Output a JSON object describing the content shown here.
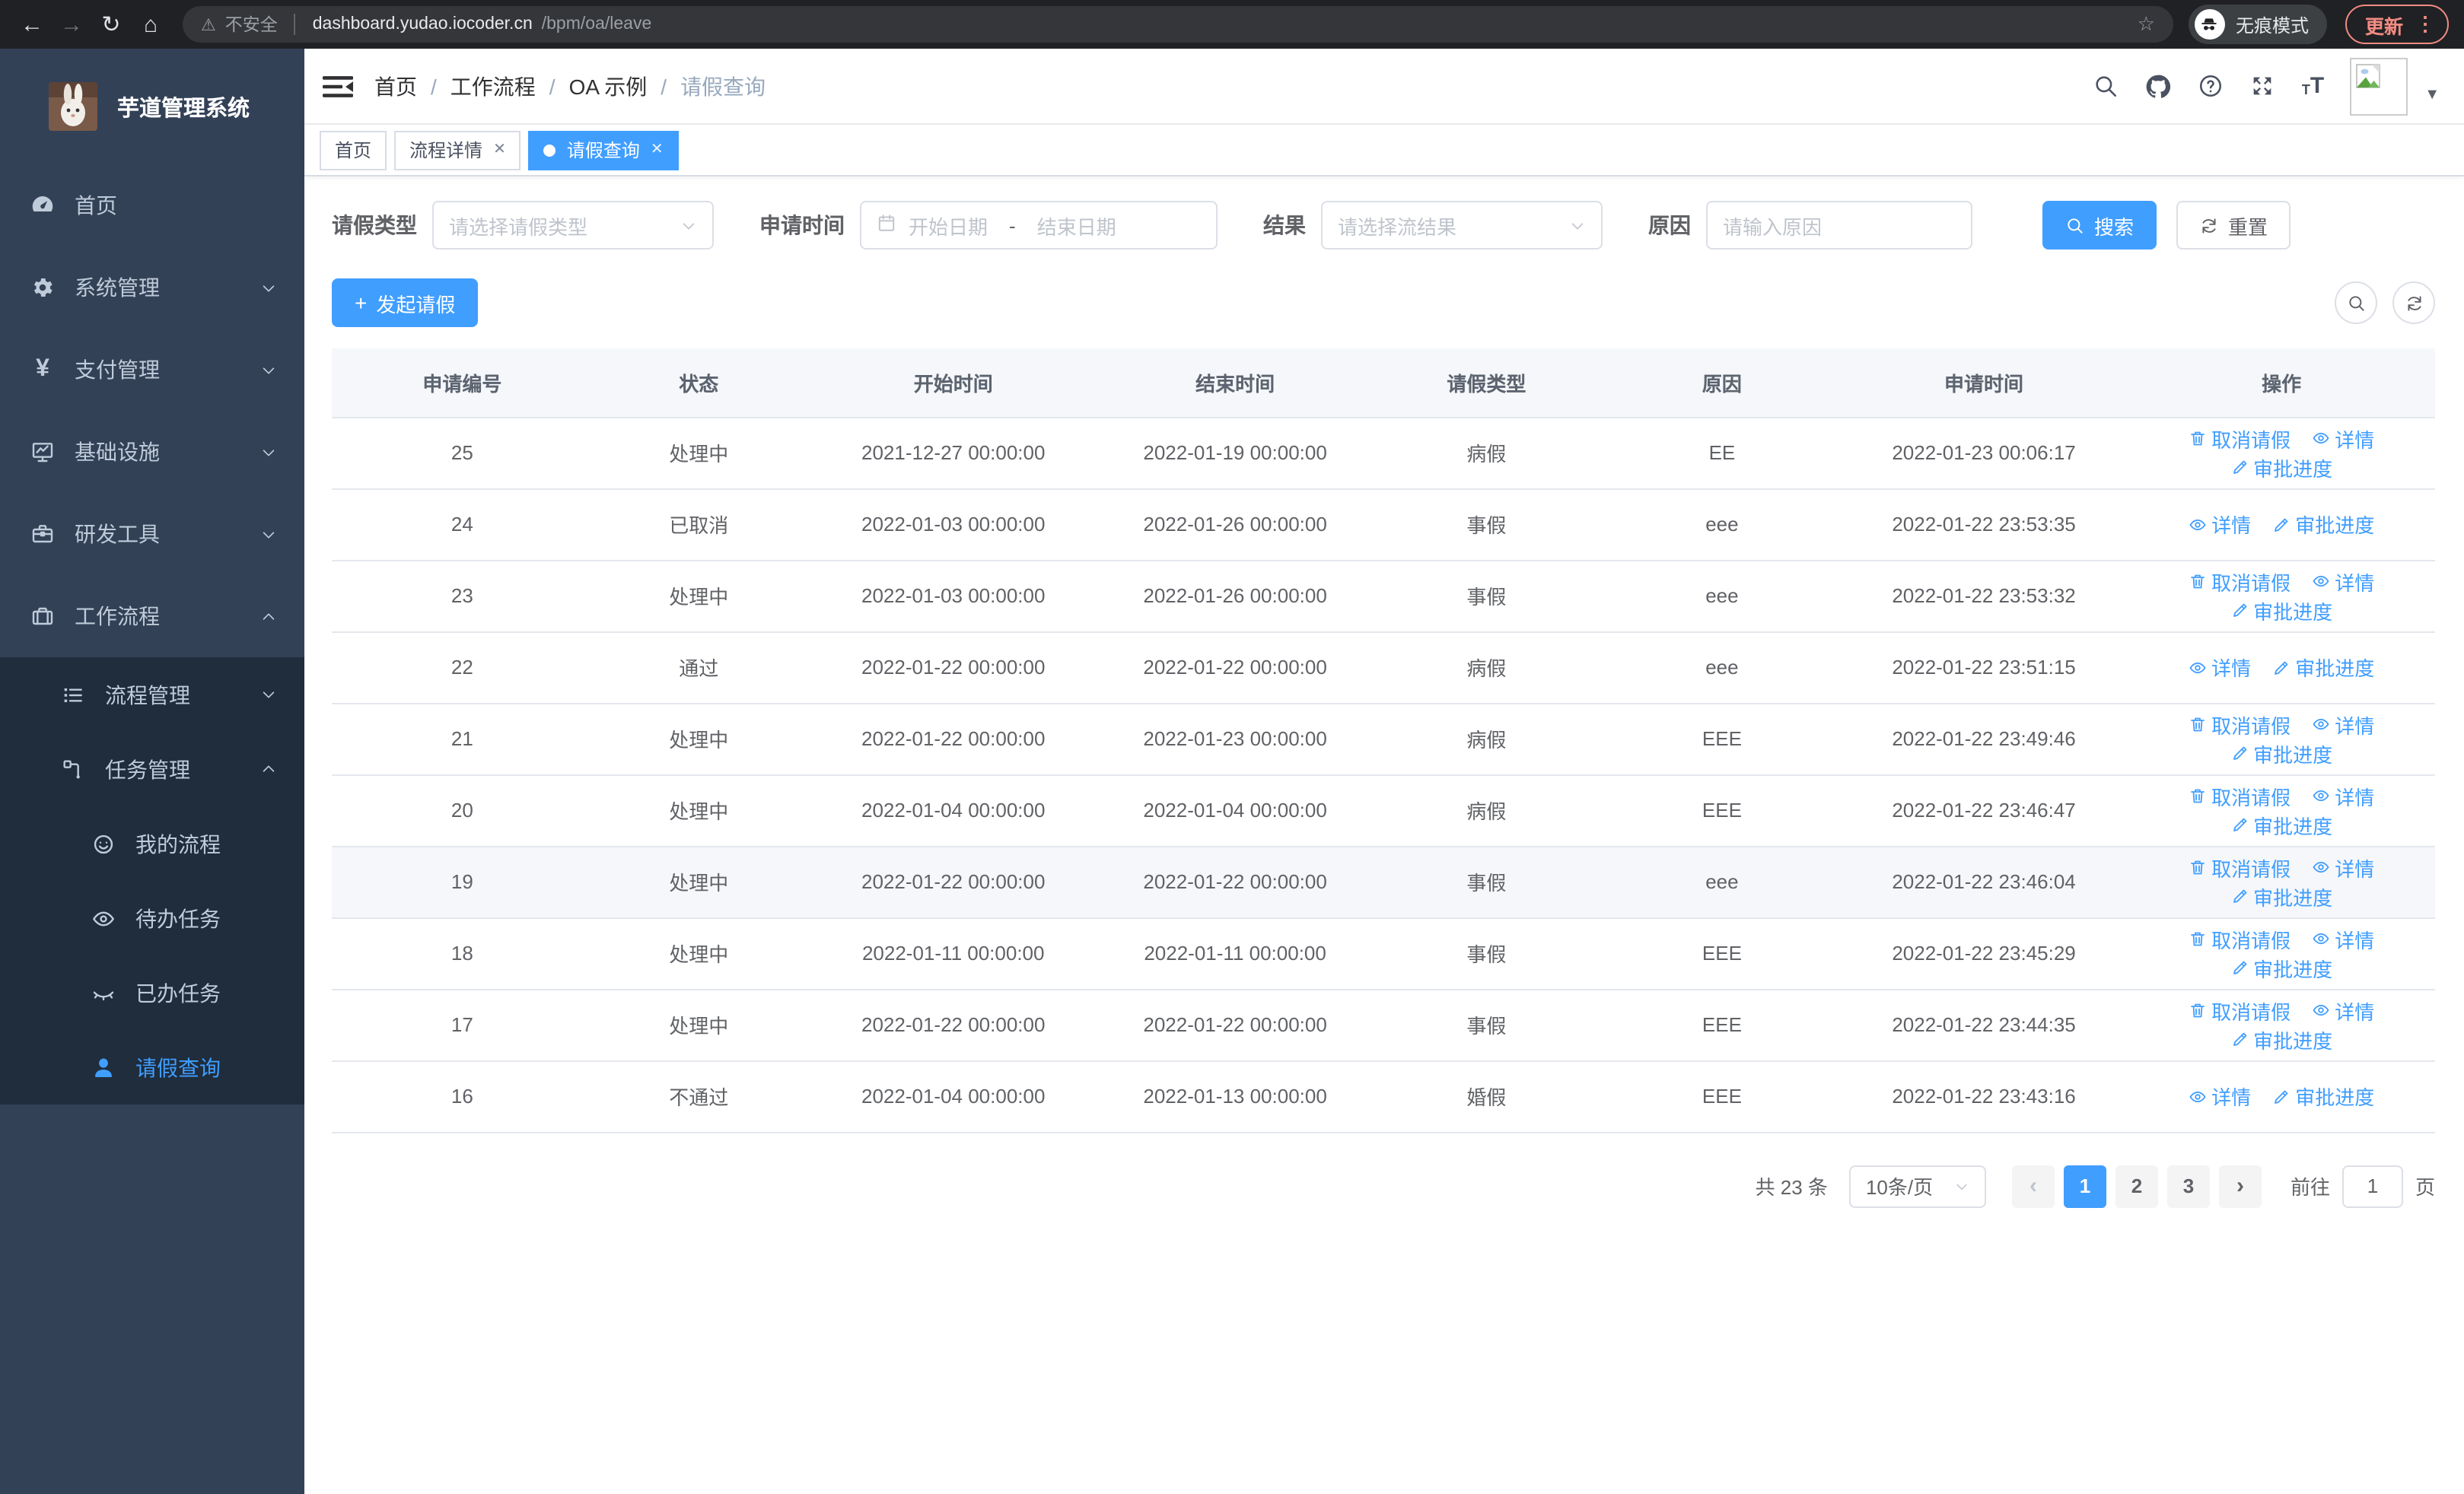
{
  "browser": {
    "security_label": "不安全",
    "url_host": "dashboard.yudao.iocoder.cn",
    "url_path": "/bpm/oa/leave",
    "incognito_label": "无痕模式",
    "update_label": "更新",
    "menu_dots": "⋮"
  },
  "sidebar": {
    "logo_title": "芋道管理系统",
    "items": [
      {
        "label": "首页",
        "icon": "dashboard-icon"
      },
      {
        "label": "系统管理",
        "icon": "gear-icon",
        "chevron": "down"
      },
      {
        "label": "支付管理",
        "icon": "yen-icon",
        "chevron": "down"
      },
      {
        "label": "基础设施",
        "icon": "monitor-icon",
        "chevron": "down"
      },
      {
        "label": "研发工具",
        "icon": "toolbox-icon",
        "chevron": "down"
      },
      {
        "label": "工作流程",
        "icon": "briefcase-icon",
        "chevron": "up"
      }
    ],
    "submenu": [
      {
        "label": "流程管理",
        "icon": "list-icon",
        "chevron": "down"
      },
      {
        "label": "任务管理",
        "icon": "tree-icon",
        "chevron": "up"
      },
      {
        "label": "我的流程",
        "icon": "face-icon"
      },
      {
        "label": "待办任务",
        "icon": "eye-open-icon"
      },
      {
        "label": "已办任务",
        "icon": "eye-closed-icon"
      },
      {
        "label": "请假查询",
        "icon": "user-icon",
        "active": true
      }
    ]
  },
  "header": {
    "breadcrumb": [
      "首页",
      "工作流程",
      "OA 示例",
      "请假查询"
    ],
    "separator": "/"
  },
  "tabs": [
    {
      "label": "首页",
      "closable": false,
      "active": false
    },
    {
      "label": "流程详情",
      "closable": true,
      "active": false
    },
    {
      "label": "请假查询",
      "closable": true,
      "active": true
    }
  ],
  "filters": {
    "leave_type": {
      "label": "请假类型",
      "placeholder": "请选择请假类型"
    },
    "apply_time": {
      "label": "申请时间",
      "start_placeholder": "开始日期",
      "separator": "-",
      "end_placeholder": "结束日期"
    },
    "result": {
      "label": "结果",
      "placeholder": "请选择流结果"
    },
    "reason": {
      "label": "原因",
      "placeholder": "请输入原因"
    },
    "search_label": "搜索",
    "reset_label": "重置"
  },
  "toolbar": {
    "create_label": "发起请假"
  },
  "table": {
    "headers": [
      "申请编号",
      "状态",
      "开始时间",
      "结束时间",
      "请假类型",
      "原因",
      "申请时间",
      "操作"
    ],
    "action_labels": {
      "cancel": "取消请假",
      "detail": "详情",
      "progress": "审批进度"
    },
    "rows": [
      {
        "id": "25",
        "status": "处理中",
        "start": "2021-12-27 00:00:00",
        "end": "2022-01-19 00:00:00",
        "type": "病假",
        "reason": "EE",
        "apply": "2022-01-23 00:06:17",
        "actions": [
          "cancel",
          "detail",
          "progress"
        ]
      },
      {
        "id": "24",
        "status": "已取消",
        "start": "2022-01-03 00:00:00",
        "end": "2022-01-26 00:00:00",
        "type": "事假",
        "reason": "eee",
        "apply": "2022-01-22 23:53:35",
        "actions": [
          "detail",
          "progress"
        ]
      },
      {
        "id": "23",
        "status": "处理中",
        "start": "2022-01-03 00:00:00",
        "end": "2022-01-26 00:00:00",
        "type": "事假",
        "reason": "eee",
        "apply": "2022-01-22 23:53:32",
        "actions": [
          "cancel",
          "detail",
          "progress"
        ]
      },
      {
        "id": "22",
        "status": "通过",
        "start": "2022-01-22 00:00:00",
        "end": "2022-01-22 00:00:00",
        "type": "病假",
        "reason": "eee",
        "apply": "2022-01-22 23:51:15",
        "actions": [
          "detail",
          "progress"
        ]
      },
      {
        "id": "21",
        "status": "处理中",
        "start": "2022-01-22 00:00:00",
        "end": "2022-01-23 00:00:00",
        "type": "病假",
        "reason": "EEE",
        "apply": "2022-01-22 23:49:46",
        "actions": [
          "cancel",
          "detail",
          "progress"
        ]
      },
      {
        "id": "20",
        "status": "处理中",
        "start": "2022-01-04 00:00:00",
        "end": "2022-01-04 00:00:00",
        "type": "病假",
        "reason": "EEE",
        "apply": "2022-01-22 23:46:47",
        "actions": [
          "cancel",
          "detail",
          "progress"
        ]
      },
      {
        "id": "19",
        "status": "处理中",
        "start": "2022-01-22 00:00:00",
        "end": "2022-01-22 00:00:00",
        "type": "事假",
        "reason": "eee",
        "apply": "2022-01-22 23:46:04",
        "actions": [
          "cancel",
          "detail",
          "progress"
        ],
        "highlighted": true
      },
      {
        "id": "18",
        "status": "处理中",
        "start": "2022-01-11 00:00:00",
        "end": "2022-01-11 00:00:00",
        "type": "事假",
        "reason": "EEE",
        "apply": "2022-01-22 23:45:29",
        "actions": [
          "cancel",
          "detail",
          "progress"
        ]
      },
      {
        "id": "17",
        "status": "处理中",
        "start": "2022-01-22 00:00:00",
        "end": "2022-01-22 00:00:00",
        "type": "事假",
        "reason": "EEE",
        "apply": "2022-01-22 23:44:35",
        "actions": [
          "cancel",
          "detail",
          "progress"
        ]
      },
      {
        "id": "16",
        "status": "不通过",
        "start": "2022-01-04 00:00:00",
        "end": "2022-01-13 00:00:00",
        "type": "婚假",
        "reason": "EEE",
        "apply": "2022-01-22 23:43:16",
        "actions": [
          "detail",
          "progress"
        ]
      }
    ]
  },
  "pagination": {
    "total": "共 23 条",
    "page_size": "10条/页",
    "pages": [
      "1",
      "2",
      "3"
    ],
    "current": "1",
    "goto_label": "前往",
    "goto_value": "1",
    "page_suffix": "页"
  },
  "colors": {
    "accent": "#409eff",
    "sidebar_bg": "#334157",
    "submenu_bg": "#1f2d3d",
    "update_badge": "#f28b82"
  }
}
